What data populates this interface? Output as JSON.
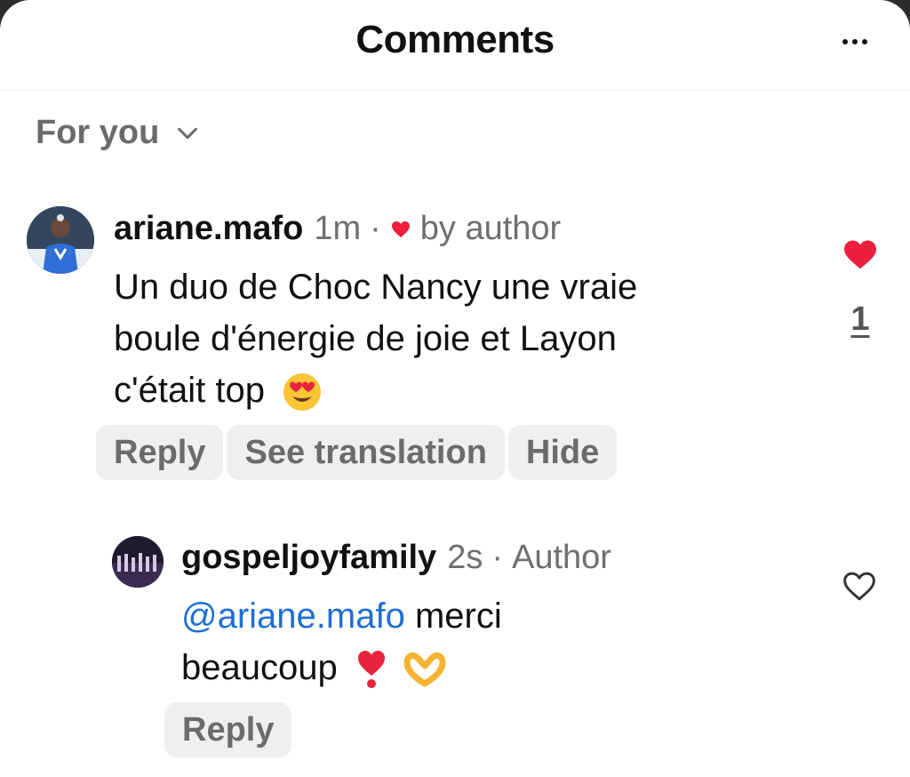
{
  "header": {
    "title": "Comments",
    "more_icon": "more-horizontal-icon"
  },
  "filter": {
    "label": "For you",
    "icon": "chevron-down-icon"
  },
  "comments": [
    {
      "username": "ariane.mafo",
      "time": "1m",
      "separator": "·",
      "liked_by": "by author",
      "text_lines": [
        "Un duo de Choc Nancy une vraie",
        "boule d'énergie de joie et Layon",
        "c'était top"
      ],
      "emoji": "heart-eyes-emoji",
      "like_count": "1",
      "liked": true,
      "actions": [
        "Reply",
        "See translation",
        "Hide"
      ]
    }
  ],
  "reply": {
    "username": "gospeljoyfamily",
    "time": "2s",
    "separator": "·",
    "badge": "Author",
    "mention": "@ariane.mafo",
    "text_after_mention": "merci",
    "text_line_2": "beaucoup",
    "emojis": [
      "heart-exclamation-emoji",
      "heart-hands-emoji"
    ],
    "liked": false,
    "actions": [
      "Reply"
    ]
  },
  "colors": {
    "accent_red": "#ed1f3d",
    "mention_blue": "#1f6ed4",
    "muted": "#6b6b6b"
  }
}
